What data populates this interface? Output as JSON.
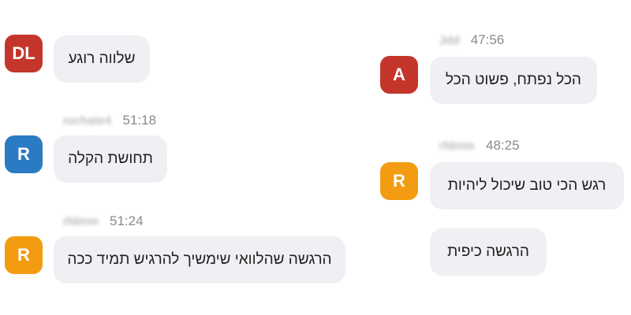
{
  "colors": {
    "avatar_red": "#c4362b",
    "avatar_blue": "#2b7bc4",
    "avatar_orange": "#f39c12",
    "bubble_bg": "#f0f0f4",
    "time_text": "#8a8a8a"
  },
  "left_column": {
    "msg1": {
      "avatar": "DL",
      "text": "שלווה רוגע"
    },
    "msg2": {
      "username": "rochale4",
      "time": "51:18",
      "avatar": "R",
      "text": "תחושת הקלה"
    },
    "msg3": {
      "username": "rfdmm",
      "time": "51:24",
      "avatar": "R",
      "text": "הרגשה שהלוואי שימשיך להרגיש תמיד ככה"
    }
  },
  "right_column": {
    "msg1": {
      "username": "Jdd",
      "time": "47:56",
      "avatar": "A",
      "text": "הכל נפתח, פשוט הכל"
    },
    "msg2": {
      "username": "rfdmm",
      "time": "48:25",
      "avatar": "R",
      "text": "רגש הכי טוב שיכול ליהיות"
    },
    "msg3": {
      "text": "הרגשה כיפית"
    }
  }
}
